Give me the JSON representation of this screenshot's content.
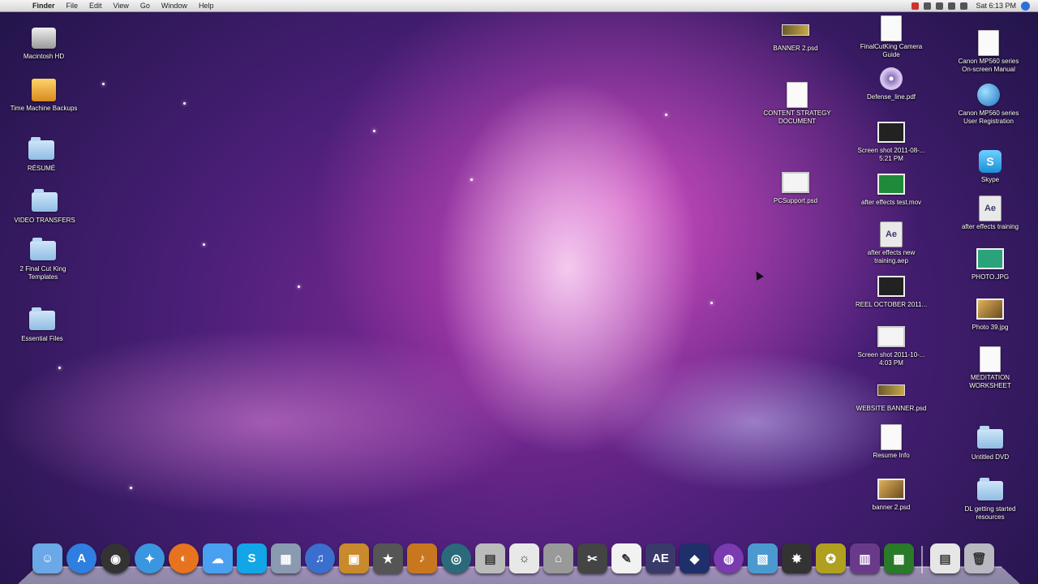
{
  "menubar": {
    "apple_glyph": "",
    "items": [
      "Finder",
      "File",
      "Edit",
      "View",
      "Go",
      "Window",
      "Help"
    ],
    "clock": "Sat 6:13 PM"
  },
  "desktop": {
    "left_icons": [
      {
        "label": "Macintosh HD",
        "icon": "hard-drive-icon"
      },
      {
        "label": "Time Machine Backups",
        "icon": "time-machine-icon"
      },
      {
        "label": "RÉSUMÉ",
        "icon": "folder-icon"
      },
      {
        "label": "VIDEO TRANSFERS",
        "icon": "folder-icon"
      },
      {
        "label": "2 Final Cut King Templates",
        "icon": "folder-icon"
      },
      {
        "label": "Essential Files",
        "icon": "folder-icon"
      }
    ],
    "mid_icons": [
      {
        "label": "BANNER 2.psd",
        "icon": "banner-thumbnail-icon"
      },
      {
        "label": "CONTENT STRATEGY DOCUMENT",
        "icon": "document-icon"
      },
      {
        "label": "PCSupport.psd",
        "icon": "image-thumbnail-icon"
      }
    ],
    "col2_icons": [
      {
        "label": "FinalCutKing Camera Guide",
        "icon": "document-icon"
      },
      {
        "label": "Defense_line.pdf",
        "icon": "pdf-icon"
      },
      {
        "label": "Screen shot 2011-08-... 5:21 PM",
        "icon": "screenshot-icon"
      },
      {
        "label": "after effects test.mov",
        "icon": "video-icon"
      },
      {
        "label": "after effects new training.aep",
        "icon": "after-effects-file-icon"
      },
      {
        "label": "REEL OCTOBER 2011...",
        "icon": "video-icon"
      },
      {
        "label": "Screen shot 2011-10-... 4:03 PM",
        "icon": "screenshot-icon"
      },
      {
        "label": "WEBSITE BANNER.psd",
        "icon": "banner-thumbnail-icon"
      },
      {
        "label": "Resume Info",
        "icon": "document-icon"
      },
      {
        "label": "banner 2.psd",
        "icon": "banner-thumbnail-icon"
      }
    ],
    "col3_icons": [
      {
        "label": "Canon MP560 series On-screen Manual",
        "icon": "manual-icon"
      },
      {
        "label": "Canon MP560 series User Registration",
        "icon": "globe-icon"
      },
      {
        "label": "Skype",
        "icon": "skype-icon"
      },
      {
        "label": "after effects training",
        "icon": "after-effects-file-icon"
      },
      {
        "label": "PHOTO.JPG",
        "icon": "image-thumbnail-icon"
      },
      {
        "label": "Photo 39.jpg",
        "icon": "photo-icon"
      },
      {
        "label": "MEDITATION WORKSHEET",
        "icon": "document-icon"
      },
      {
        "label": "Untitled DVD",
        "icon": "folder-icon"
      },
      {
        "label": "DL getting started resources",
        "icon": "folder-icon"
      }
    ]
  },
  "dock": {
    "items": [
      {
        "name": "finder",
        "icon": "finder-icon",
        "glyph": "☺",
        "color": "#6aa8e8"
      },
      {
        "name": "app-store",
        "icon": "app-store-icon",
        "glyph": "A",
        "color": "#2f7fe0"
      },
      {
        "name": "dashboard",
        "icon": "dashboard-icon",
        "glyph": "◉",
        "color": "#333333"
      },
      {
        "name": "safari",
        "icon": "safari-icon",
        "glyph": "✦",
        "color": "#3a96e0"
      },
      {
        "name": "firefox",
        "icon": "firefox-icon",
        "glyph": "◐",
        "color": "#e8731e"
      },
      {
        "name": "ichat",
        "icon": "ichat-icon",
        "glyph": "☁",
        "color": "#4aa0f0"
      },
      {
        "name": "skype",
        "icon": "skype-icon",
        "glyph": "S",
        "color": "#12a5e8"
      },
      {
        "name": "preview",
        "icon": "preview-icon",
        "glyph": "▦",
        "color": "#8a9ab0"
      },
      {
        "name": "itunes",
        "icon": "itunes-icon",
        "glyph": "♫",
        "color": "#3a6fd0"
      },
      {
        "name": "iphoto",
        "icon": "iphoto-icon",
        "glyph": "▣",
        "color": "#c88a2a"
      },
      {
        "name": "imovie",
        "icon": "imovie-icon",
        "glyph": "★",
        "color": "#555555"
      },
      {
        "name": "garageband",
        "icon": "garageband-icon",
        "glyph": "♪",
        "color": "#c9771e"
      },
      {
        "name": "time-machine",
        "icon": "time-machine-icon",
        "glyph": "◎",
        "color": "#2a6a7a"
      },
      {
        "name": "photo-booth",
        "icon": "photo-booth-icon",
        "glyph": "▤",
        "color": "#bbbbbb"
      },
      {
        "name": "ideas",
        "icon": "lightbulb-icon",
        "glyph": "☼",
        "color": "#e8e8e8"
      },
      {
        "name": "image-capture",
        "icon": "image-capture-icon",
        "glyph": "⌂",
        "color": "#999999"
      },
      {
        "name": "final-cut",
        "icon": "clapper-icon",
        "glyph": "✂",
        "color": "#444444"
      },
      {
        "name": "pages",
        "icon": "pages-icon",
        "glyph": "✎",
        "color": "#f2f2f2"
      },
      {
        "name": "after-effects",
        "icon": "after-effects-icon",
        "glyph": "AE",
        "color": "#3a3a6a"
      },
      {
        "name": "motion",
        "icon": "motion-icon",
        "glyph": "◆",
        "color": "#1f2f6a"
      },
      {
        "name": "color",
        "icon": "color-wheel-icon",
        "glyph": "◍",
        "color": "#7a3ab0"
      },
      {
        "name": "preview-2",
        "icon": "picture-icon",
        "glyph": "▧",
        "color": "#4a9ad0"
      },
      {
        "name": "compressor",
        "icon": "compressor-icon",
        "glyph": "✸",
        "color": "#333333"
      },
      {
        "name": "dvd-studio",
        "icon": "dvd-studio-icon",
        "glyph": "✪",
        "color": "#b0a020"
      },
      {
        "name": "soundtrack",
        "icon": "film-strip-icon",
        "glyph": "▥",
        "color": "#6a3a8a"
      },
      {
        "name": "quicktime",
        "icon": "film-icon",
        "glyph": "▩",
        "color": "#2a7a2a"
      }
    ],
    "right_items": [
      {
        "name": "documents-stack",
        "icon": "documents-stack-icon",
        "glyph": "▤",
        "color": "#e6e6e6"
      },
      {
        "name": "trash",
        "icon": "trash-icon",
        "glyph": "🗑",
        "color": "#b8b8c0"
      }
    ]
  }
}
